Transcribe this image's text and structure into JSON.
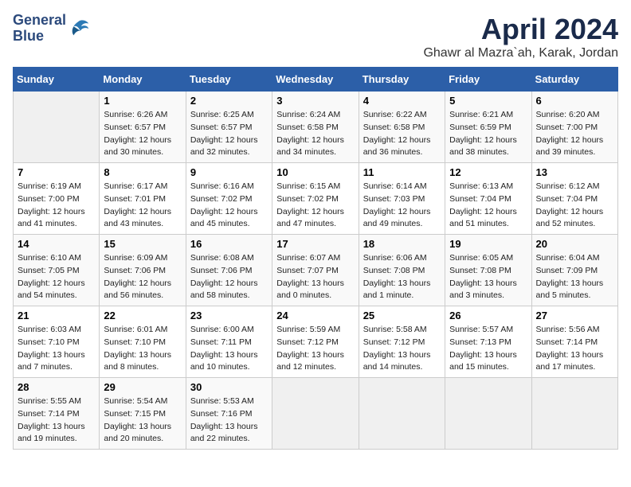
{
  "header": {
    "logo_line1": "General",
    "logo_line2": "Blue",
    "month_title": "April 2024",
    "location": "Ghawr al Mazra`ah, Karak, Jordan"
  },
  "weekdays": [
    "Sunday",
    "Monday",
    "Tuesday",
    "Wednesday",
    "Thursday",
    "Friday",
    "Saturday"
  ],
  "weeks": [
    [
      {
        "day": "",
        "info": ""
      },
      {
        "day": "1",
        "info": "Sunrise: 6:26 AM\nSunset: 6:57 PM\nDaylight: 12 hours\nand 30 minutes."
      },
      {
        "day": "2",
        "info": "Sunrise: 6:25 AM\nSunset: 6:57 PM\nDaylight: 12 hours\nand 32 minutes."
      },
      {
        "day": "3",
        "info": "Sunrise: 6:24 AM\nSunset: 6:58 PM\nDaylight: 12 hours\nand 34 minutes."
      },
      {
        "day": "4",
        "info": "Sunrise: 6:22 AM\nSunset: 6:58 PM\nDaylight: 12 hours\nand 36 minutes."
      },
      {
        "day": "5",
        "info": "Sunrise: 6:21 AM\nSunset: 6:59 PM\nDaylight: 12 hours\nand 38 minutes."
      },
      {
        "day": "6",
        "info": "Sunrise: 6:20 AM\nSunset: 7:00 PM\nDaylight: 12 hours\nand 39 minutes."
      }
    ],
    [
      {
        "day": "7",
        "info": "Sunrise: 6:19 AM\nSunset: 7:00 PM\nDaylight: 12 hours\nand 41 minutes."
      },
      {
        "day": "8",
        "info": "Sunrise: 6:17 AM\nSunset: 7:01 PM\nDaylight: 12 hours\nand 43 minutes."
      },
      {
        "day": "9",
        "info": "Sunrise: 6:16 AM\nSunset: 7:02 PM\nDaylight: 12 hours\nand 45 minutes."
      },
      {
        "day": "10",
        "info": "Sunrise: 6:15 AM\nSunset: 7:02 PM\nDaylight: 12 hours\nand 47 minutes."
      },
      {
        "day": "11",
        "info": "Sunrise: 6:14 AM\nSunset: 7:03 PM\nDaylight: 12 hours\nand 49 minutes."
      },
      {
        "day": "12",
        "info": "Sunrise: 6:13 AM\nSunset: 7:04 PM\nDaylight: 12 hours\nand 51 minutes."
      },
      {
        "day": "13",
        "info": "Sunrise: 6:12 AM\nSunset: 7:04 PM\nDaylight: 12 hours\nand 52 minutes."
      }
    ],
    [
      {
        "day": "14",
        "info": "Sunrise: 6:10 AM\nSunset: 7:05 PM\nDaylight: 12 hours\nand 54 minutes."
      },
      {
        "day": "15",
        "info": "Sunrise: 6:09 AM\nSunset: 7:06 PM\nDaylight: 12 hours\nand 56 minutes."
      },
      {
        "day": "16",
        "info": "Sunrise: 6:08 AM\nSunset: 7:06 PM\nDaylight: 12 hours\nand 58 minutes."
      },
      {
        "day": "17",
        "info": "Sunrise: 6:07 AM\nSunset: 7:07 PM\nDaylight: 13 hours\nand 0 minutes."
      },
      {
        "day": "18",
        "info": "Sunrise: 6:06 AM\nSunset: 7:08 PM\nDaylight: 13 hours\nand 1 minute."
      },
      {
        "day": "19",
        "info": "Sunrise: 6:05 AM\nSunset: 7:08 PM\nDaylight: 13 hours\nand 3 minutes."
      },
      {
        "day": "20",
        "info": "Sunrise: 6:04 AM\nSunset: 7:09 PM\nDaylight: 13 hours\nand 5 minutes."
      }
    ],
    [
      {
        "day": "21",
        "info": "Sunrise: 6:03 AM\nSunset: 7:10 PM\nDaylight: 13 hours\nand 7 minutes."
      },
      {
        "day": "22",
        "info": "Sunrise: 6:01 AM\nSunset: 7:10 PM\nDaylight: 13 hours\nand 8 minutes."
      },
      {
        "day": "23",
        "info": "Sunrise: 6:00 AM\nSunset: 7:11 PM\nDaylight: 13 hours\nand 10 minutes."
      },
      {
        "day": "24",
        "info": "Sunrise: 5:59 AM\nSunset: 7:12 PM\nDaylight: 13 hours\nand 12 minutes."
      },
      {
        "day": "25",
        "info": "Sunrise: 5:58 AM\nSunset: 7:12 PM\nDaylight: 13 hours\nand 14 minutes."
      },
      {
        "day": "26",
        "info": "Sunrise: 5:57 AM\nSunset: 7:13 PM\nDaylight: 13 hours\nand 15 minutes."
      },
      {
        "day": "27",
        "info": "Sunrise: 5:56 AM\nSunset: 7:14 PM\nDaylight: 13 hours\nand 17 minutes."
      }
    ],
    [
      {
        "day": "28",
        "info": "Sunrise: 5:55 AM\nSunset: 7:14 PM\nDaylight: 13 hours\nand 19 minutes."
      },
      {
        "day": "29",
        "info": "Sunrise: 5:54 AM\nSunset: 7:15 PM\nDaylight: 13 hours\nand 20 minutes."
      },
      {
        "day": "30",
        "info": "Sunrise: 5:53 AM\nSunset: 7:16 PM\nDaylight: 13 hours\nand 22 minutes."
      },
      {
        "day": "",
        "info": ""
      },
      {
        "day": "",
        "info": ""
      },
      {
        "day": "",
        "info": ""
      },
      {
        "day": "",
        "info": ""
      }
    ]
  ]
}
